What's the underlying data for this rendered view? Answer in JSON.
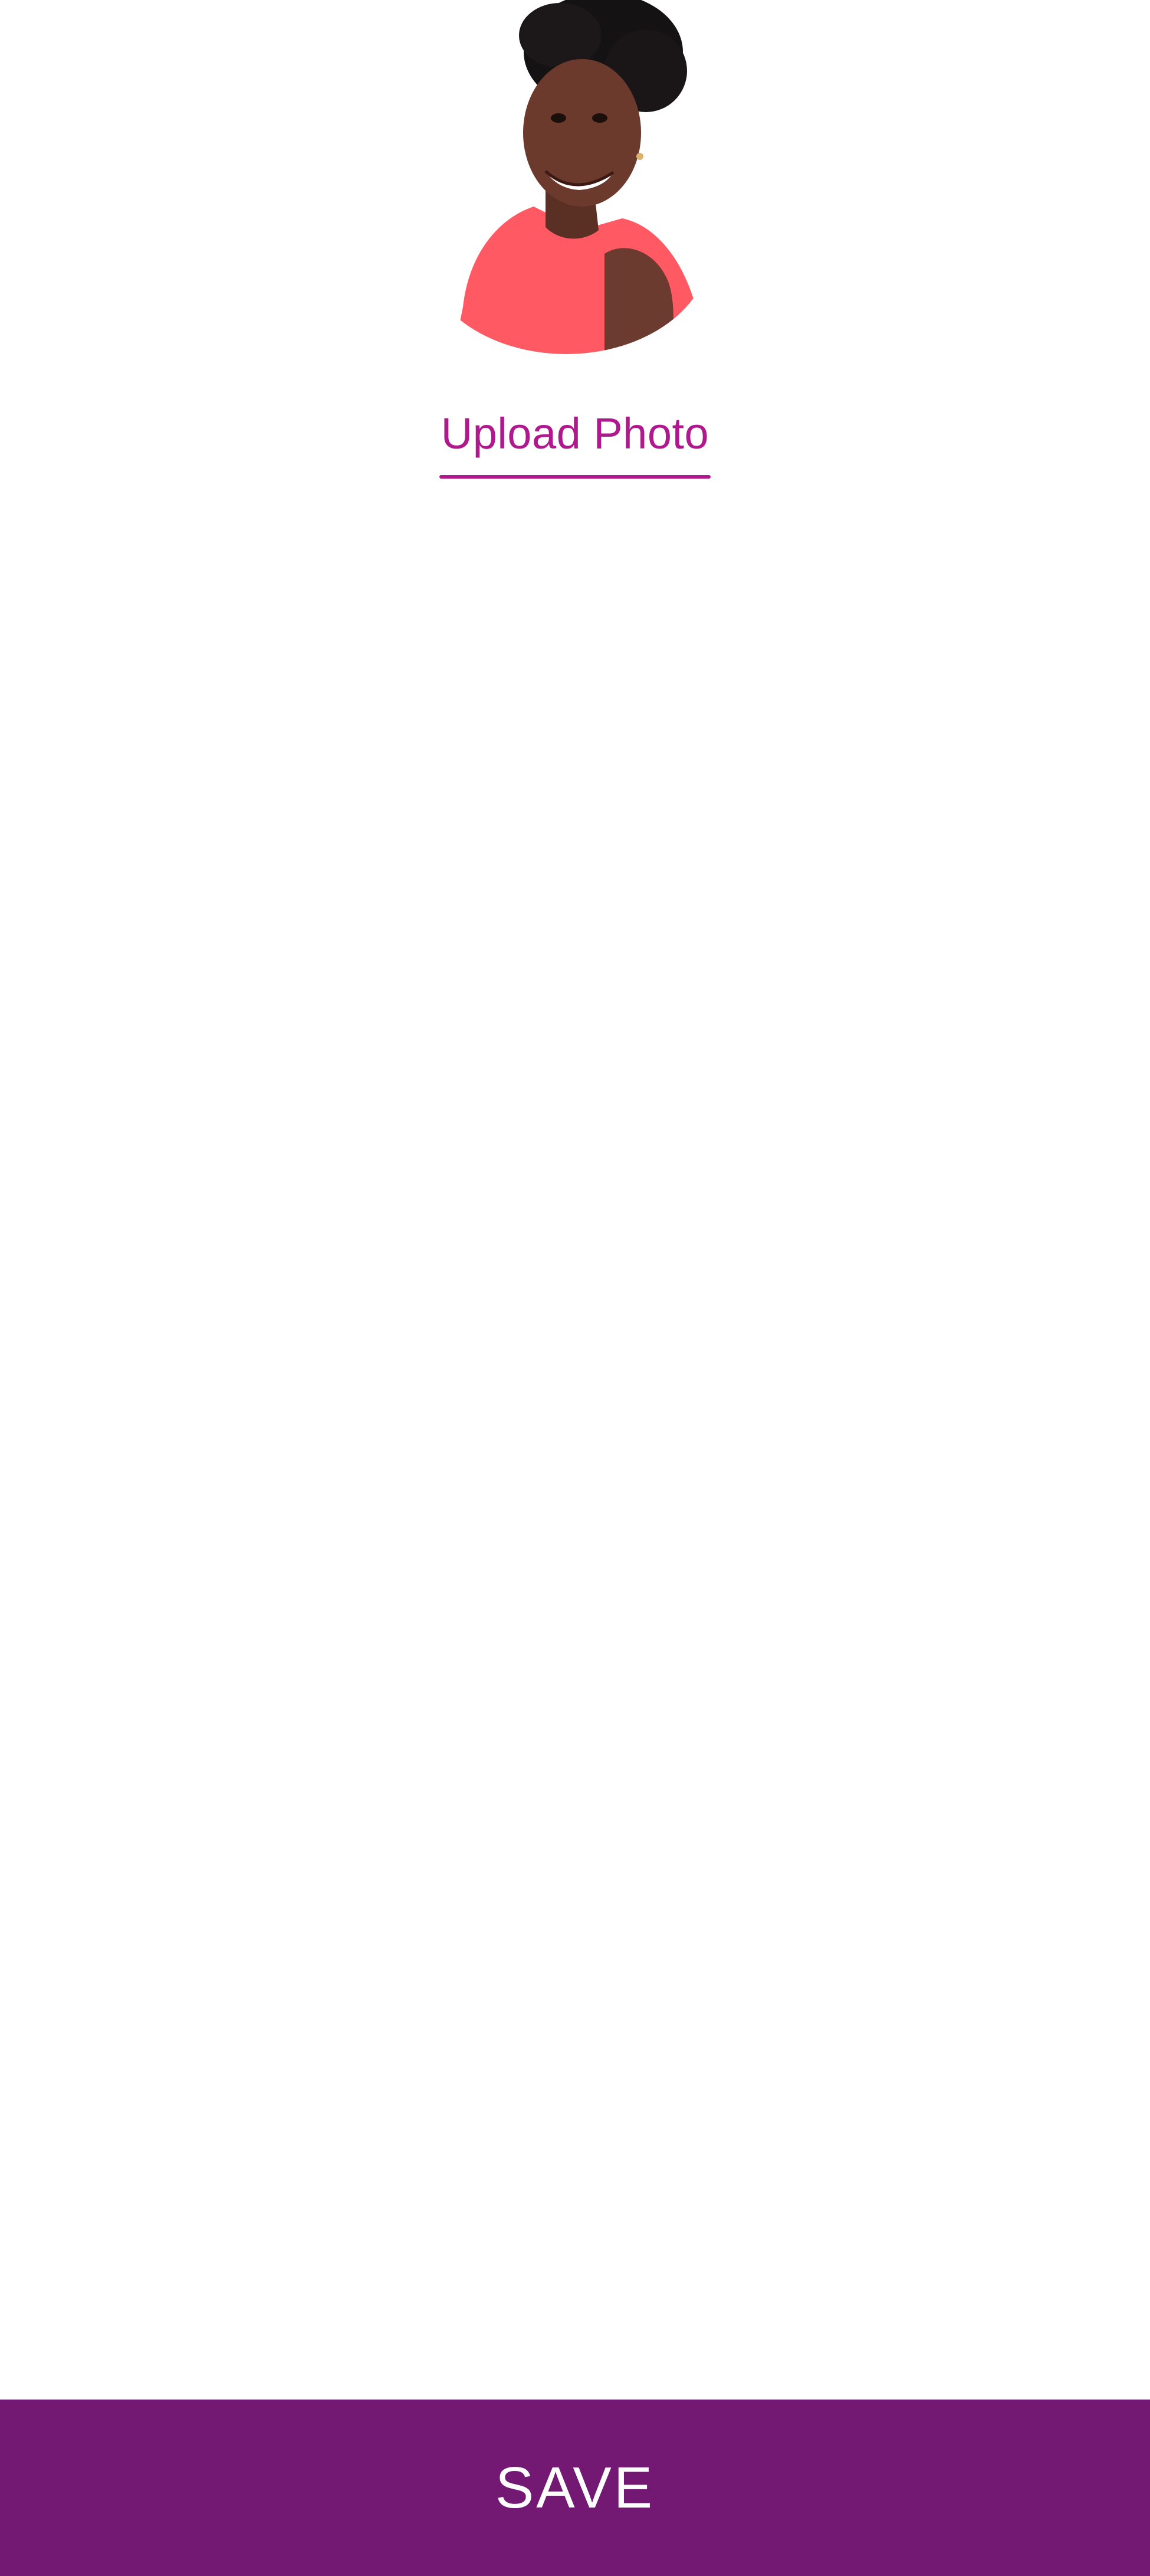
{
  "profile": {
    "avatar_icon": "profile-photo",
    "upload_label": "Upload Photo"
  },
  "footer": {
    "save_label": "SAVE"
  },
  "colors": {
    "accent": "#b0198e",
    "save_bar": "#731974",
    "background": "#ffffff"
  }
}
